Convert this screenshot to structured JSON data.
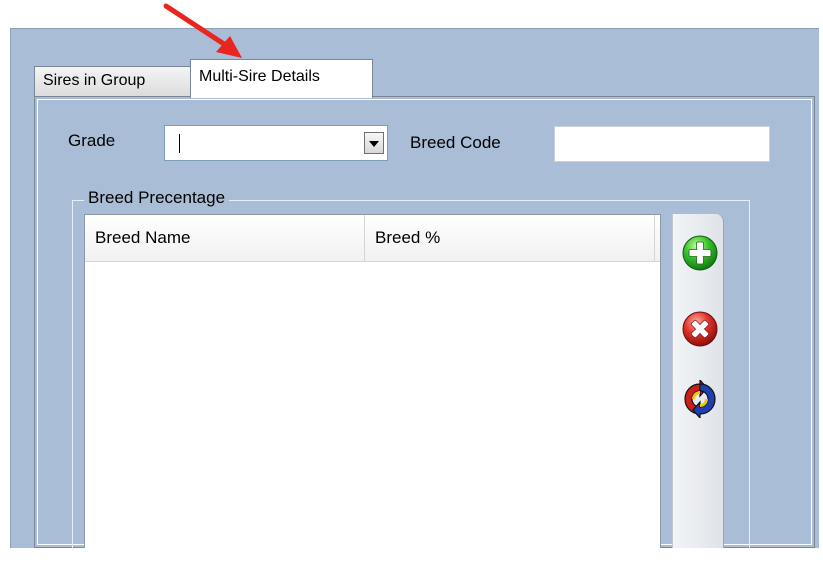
{
  "tabs": [
    {
      "label": "Sires in Group",
      "active": false
    },
    {
      "label": "Multi-Sire Details",
      "active": true
    }
  ],
  "form": {
    "grade_label": "Grade",
    "grade_value": "",
    "breed_code_label": "Breed Code",
    "breed_code_value": ""
  },
  "breed_group": {
    "title": "Breed Precentage",
    "columns": [
      "Breed Name",
      "Breed %"
    ],
    "rows": []
  },
  "toolbar": {
    "icons": [
      "add-icon",
      "delete-icon",
      "refresh-icon"
    ]
  },
  "colors": {
    "panel_background": "#aabdd6",
    "annotation_arrow": "#e8251e"
  }
}
